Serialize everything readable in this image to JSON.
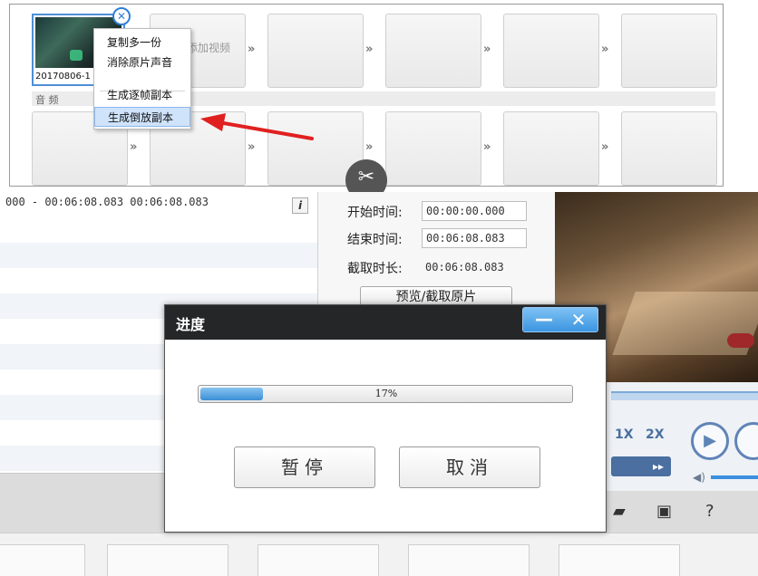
{
  "storyboard": {
    "thumb_name": "20170806-1",
    "empty_slot_hint": "添加视频",
    "audio_label": "音 频",
    "context_menu": [
      "复制多一份",
      "消除原片声音",
      "生成逐帧副本",
      "生成倒放副本"
    ],
    "active_menu_index": 3
  },
  "clip_list": {
    "first_row": "000 - 00:06:08.083     00:06:08.083"
  },
  "times": {
    "start_label": "开始时间:",
    "start_value": "00:00:00.000",
    "end_label": "结束时间:",
    "end_value": "00:06:08.083",
    "duration_label": "截取时长:",
    "duration_value": "00:06:08.083",
    "preview_button": "预览/截取原片"
  },
  "player": {
    "speed_1x": "1X",
    "speed_2x": "2X"
  },
  "dialog": {
    "title": "进度",
    "minimize": "—",
    "close": "✕",
    "progress": 0.17,
    "progress_text": "17%",
    "pause_button": "暂停",
    "cancel_button": "取消"
  },
  "colors": {
    "accent_blue": "#3b8fd6",
    "title_bar": "#252628",
    "arrow_red": "#e02020"
  }
}
